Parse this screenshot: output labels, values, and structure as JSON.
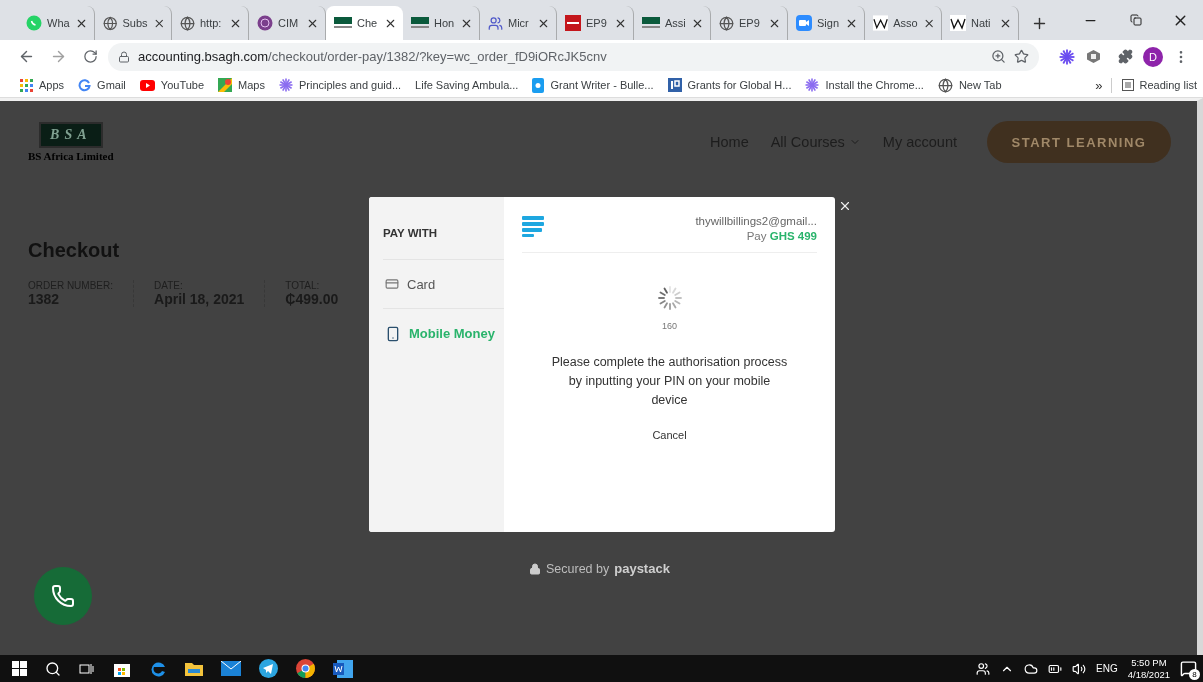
{
  "browser": {
    "tabs": [
      {
        "title": "Wha",
        "kind": "whatsapp",
        "selected": false
      },
      {
        "title": "Subs",
        "kind": "globe",
        "selected": false
      },
      {
        "title": "http:",
        "kind": "globe",
        "selected": false
      },
      {
        "title": "CIM",
        "kind": "cima",
        "selected": false
      },
      {
        "title": "Che",
        "kind": "bsa",
        "selected": true
      },
      {
        "title": "Hon",
        "kind": "bsa",
        "selected": false
      },
      {
        "title": "Micr",
        "kind": "teams",
        "selected": false
      },
      {
        "title": "EP9",
        "kind": "acca",
        "selected": false
      },
      {
        "title": "Assi",
        "kind": "bsa",
        "selected": false
      },
      {
        "title": "EP9",
        "kind": "globe",
        "selected": false
      },
      {
        "title": "Sign",
        "kind": "zoom",
        "selected": false
      },
      {
        "title": "Asso",
        "kind": "wiki",
        "selected": false
      },
      {
        "title": "Nati",
        "kind": "wiki",
        "selected": false
      }
    ],
    "url_host": "accounting.bsagh.com",
    "url_path": "/checkout/order-pay/1382/?key=wc_order_fD9iORcJK5cnv",
    "profile": "D",
    "bookmarks": [
      {
        "label": "Apps",
        "kind": "apps"
      },
      {
        "label": "Gmail",
        "kind": "google"
      },
      {
        "label": "YouTube",
        "kind": "youtube"
      },
      {
        "label": "Maps",
        "kind": "maps"
      },
      {
        "label": "Principles and guid...",
        "kind": "sun"
      },
      {
        "label": "Life Saving Ambula...",
        "kind": "none"
      },
      {
        "label": "Grant Writer - Bulle...",
        "kind": "bubble"
      },
      {
        "label": "Grants for Global H...",
        "kind": "ip"
      },
      {
        "label": "Install the Chrome...",
        "kind": "sun"
      },
      {
        "label": "New Tab",
        "kind": "globe"
      }
    ],
    "more": "»",
    "reading_list": "Reading list"
  },
  "site": {
    "logo": "BSA",
    "company": "BS Africa Limited",
    "nav": [
      {
        "label": "Home",
        "dropdown": false
      },
      {
        "label": "All Courses",
        "dropdown": true
      },
      {
        "label": "My account",
        "dropdown": false
      }
    ],
    "cta": "START LEARNING",
    "heading": "Checkout",
    "order": [
      {
        "label": "ORDER NUMBER:",
        "value": "1382"
      },
      {
        "label": "DATE:",
        "value": "April 18, 2021"
      },
      {
        "label": "TOTAL:",
        "value": "₵499.00"
      }
    ]
  },
  "modal": {
    "pay_with": "PAY WITH",
    "methods": [
      {
        "label": "Card",
        "kind": "card",
        "selected": false
      },
      {
        "label": "Mobile Money",
        "kind": "mobile",
        "selected": true
      }
    ],
    "email": "thywillbillings2@gmail...",
    "pay_label": "Pay",
    "amount": "GHS 499",
    "countdown": "160",
    "message": "Please complete the authorisation process by inputting your PIN on your mobile device",
    "cancel": "Cancel",
    "secured": "Secured by",
    "brand": "paystack"
  },
  "taskbar": {
    "language": "ENG",
    "time": "5:50 PM",
    "date": "4/18/2021",
    "notifications": "8"
  }
}
